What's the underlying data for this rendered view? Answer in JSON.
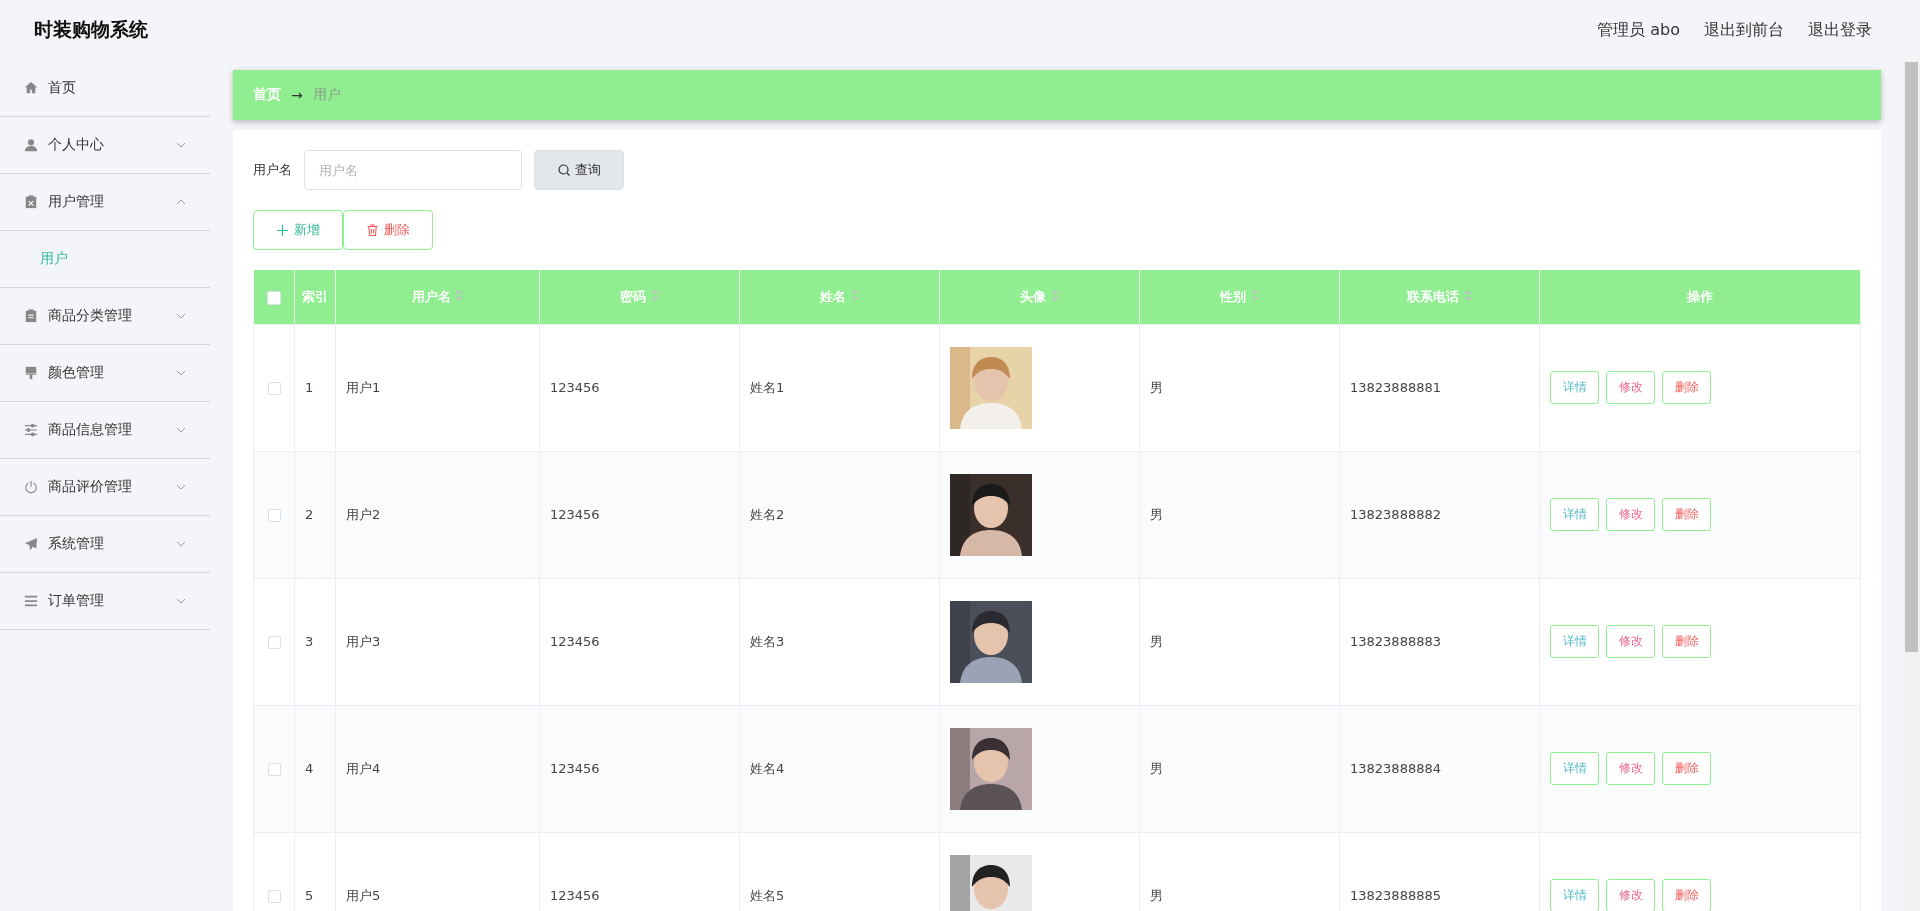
{
  "header": {
    "title": "时装购物系统",
    "user": "管理员 abo",
    "links": [
      "退出到前台",
      "退出登录"
    ]
  },
  "sidebar": {
    "items": [
      {
        "kind": "home",
        "label": "首页"
      },
      {
        "kind": "person",
        "label": "个人中心",
        "expanded": false
      },
      {
        "kind": "clipboard-x",
        "label": "用户管理",
        "expanded": true,
        "children": [
          {
            "label": "用户",
            "selected": true
          }
        ]
      },
      {
        "kind": "clipboard",
        "label": "商品分类管理",
        "expanded": false
      },
      {
        "kind": "brush",
        "label": "颜色管理",
        "expanded": false
      },
      {
        "kind": "sliders",
        "label": "商品信息管理",
        "expanded": false
      },
      {
        "kind": "power",
        "label": "商品评价管理",
        "expanded": false
      },
      {
        "kind": "send",
        "label": "系统管理",
        "expanded": false
      },
      {
        "kind": "list",
        "label": "订单管理",
        "expanded": false
      }
    ]
  },
  "breadcrumb": [
    "首页",
    "→",
    "用户"
  ],
  "search": {
    "label": "用户名",
    "placeholder": "用户名",
    "button": "查询"
  },
  "actions": [
    {
      "kind": "add",
      "label": "新增"
    },
    {
      "kind": "delete",
      "label": "删除"
    }
  ],
  "table": {
    "all_checked": false,
    "columns": [
      {
        "label": "索引",
        "sortable": false
      },
      {
        "label": "用户名",
        "sortable": true
      },
      {
        "label": "密码",
        "sortable": true
      },
      {
        "label": "姓名",
        "sortable": true
      },
      {
        "label": "头像",
        "sortable": true
      },
      {
        "label": "性别",
        "sortable": true
      },
      {
        "label": "联系电话",
        "sortable": true
      },
      {
        "label": "操作",
        "sortable": false
      }
    ],
    "rows": [
      {
        "checked": false,
        "index": "1",
        "username": "用户1",
        "password": "123456",
        "name": "姓名1",
        "gender": "男",
        "phone": "13823888881",
        "buttons": [
          "详情",
          "修改",
          "删除"
        ]
      },
      {
        "checked": false,
        "index": "2",
        "username": "用户2",
        "password": "123456",
        "name": "姓名2",
        "gender": "男",
        "phone": "13823888882",
        "buttons": [
          "详情",
          "修改",
          "删除"
        ]
      },
      {
        "checked": false,
        "index": "3",
        "username": "用户3",
        "password": "123456",
        "name": "姓名3",
        "gender": "男",
        "phone": "13823888883",
        "buttons": [
          "详情",
          "修改",
          "删除"
        ]
      },
      {
        "checked": false,
        "index": "4",
        "username": "用户4",
        "password": "123456",
        "name": "姓名4",
        "gender": "男",
        "phone": "13823888884",
        "buttons": [
          "详情",
          "修改",
          "删除"
        ]
      },
      {
        "checked": false,
        "index": "5",
        "username": "用户5",
        "password": "123456",
        "name": "姓名5",
        "gender": "男",
        "phone": "13823888885",
        "buttons": [
          "详情",
          "修改",
          "删除"
        ]
      }
    ]
  }
}
